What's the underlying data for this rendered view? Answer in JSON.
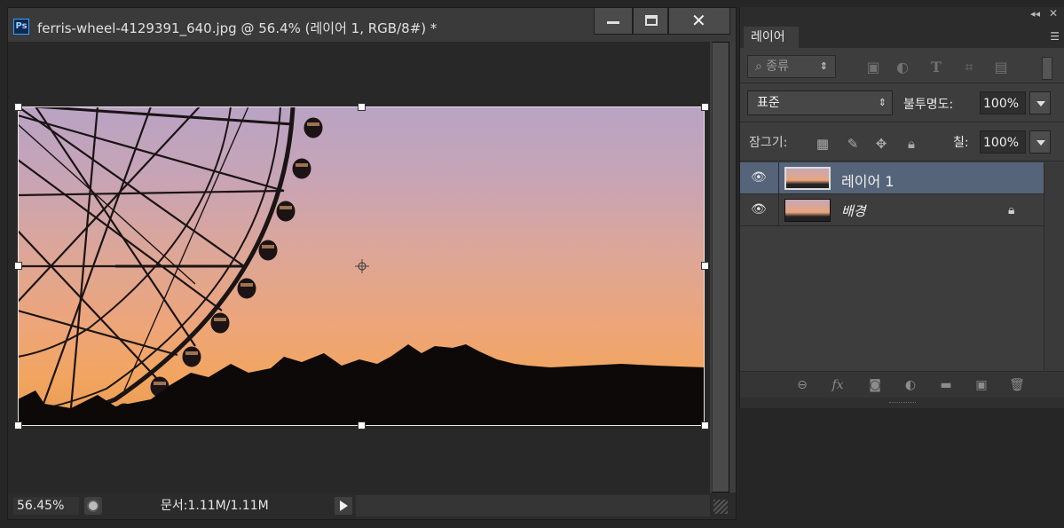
{
  "document": {
    "app_icon_label": "Ps",
    "title": "ferris-wheel-4129391_640.jpg @ 56.4% (레이어 1, RGB/8#) *",
    "window_buttons": {
      "minimize": "minimize-icon",
      "maximize": "maximize-icon",
      "close": "✕"
    },
    "status": {
      "zoom": "56.45%",
      "info": "문서:1.11M/1.11M"
    }
  },
  "layers_panel": {
    "tab_label": "레이어",
    "collapse_glyph": "◂◂",
    "close_glyph": "✕",
    "menu_glyph": "☰",
    "filter": {
      "kind_label": "종류",
      "icons": [
        "image-filter-icon",
        "adjustment-filter-icon",
        "type-filter-icon",
        "shape-filter-icon",
        "smart-object-filter-icon"
      ]
    },
    "blend_mode": "표준",
    "opacity_label": "불투명도:",
    "opacity_value": "100%",
    "lock_label": "잠그기:",
    "lock_icons": [
      "lock-transparent-icon",
      "lock-image-icon",
      "lock-position-icon",
      "lock-all-icon"
    ],
    "fill_label": "칠:",
    "fill_value": "100%",
    "layers": [
      {
        "name": "레이어 1",
        "selected": true,
        "visible": true,
        "locked": false
      },
      {
        "name": "배경",
        "selected": false,
        "visible": true,
        "locked": true
      }
    ],
    "footer_icons": [
      "link-icon",
      "fx-icon",
      "mask-icon",
      "adjustment-icon",
      "folder-icon",
      "new-layer-icon",
      "trash-icon"
    ]
  }
}
